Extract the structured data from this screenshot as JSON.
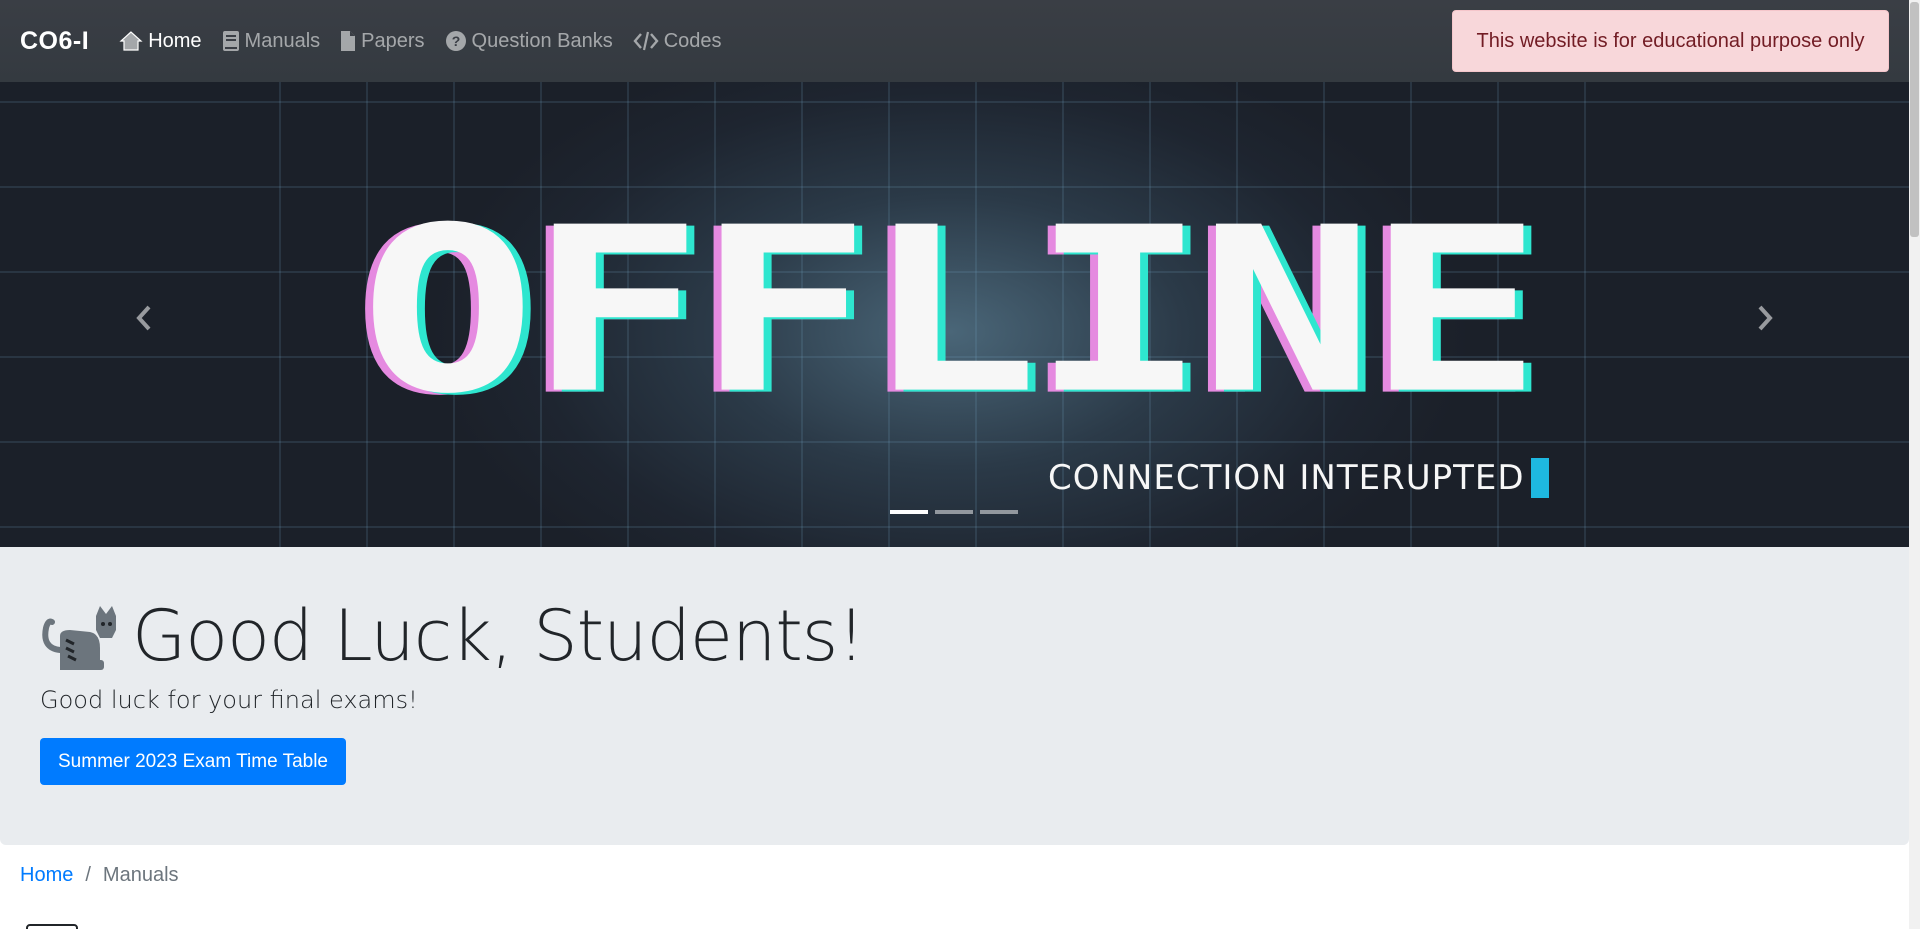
{
  "navbar": {
    "brand": "CO6-I",
    "items": [
      {
        "label": "Home",
        "icon": "home-icon",
        "active": true
      },
      {
        "label": "Manuals",
        "icon": "book-icon",
        "active": false
      },
      {
        "label": "Papers",
        "icon": "document-icon",
        "active": false
      },
      {
        "label": "Question Banks",
        "icon": "question-circle-icon",
        "active": false
      },
      {
        "label": "Codes",
        "icon": "code-icon",
        "active": false
      }
    ],
    "alert": "This website is for educational purpose only"
  },
  "carousel": {
    "slide_text": "OFFLINE",
    "slide_subtext": "CONNECTION INTERUPTED",
    "active_slide": 1,
    "slide_count": 3,
    "prev_icon": "chevron-left-icon",
    "next_icon": "chevron-right-icon"
  },
  "jumbotron": {
    "icon": "cat-icon",
    "title": "Good Luck, Students!",
    "lead": "Good luck for your final exams!",
    "button": "Summer 2023 Exam Time Table"
  },
  "breadcrumb": {
    "home": "Home",
    "separator": "/",
    "current": "Manuals"
  },
  "colors": {
    "navbar": "#343a40",
    "alert_bg": "#f8d7da",
    "alert_text": "#721c24",
    "primary": "#007bff",
    "jumbotron_bg": "#e9ecef",
    "glitch_pink": "#e58ae0",
    "glitch_cyan": "#2ee6cf"
  }
}
